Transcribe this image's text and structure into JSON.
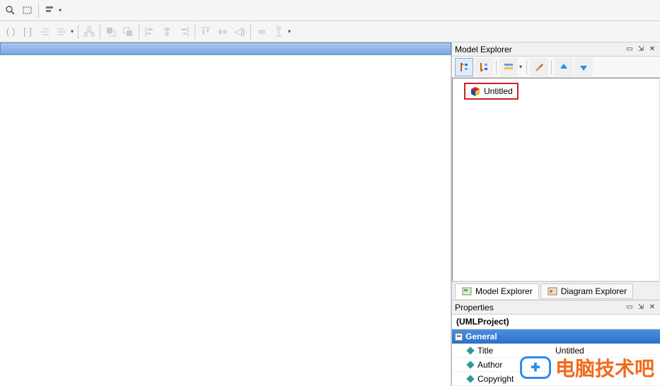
{
  "toolbars": {
    "row1": {
      "buttons": [
        "zoom",
        "rectangle-select",
        "align"
      ]
    },
    "row2": {
      "buttons": [
        "parentheses",
        "brackets",
        "outdent",
        "indent",
        "ungroup",
        "group-fwd",
        "group-back",
        "align-left",
        "align-center",
        "align-right",
        "dist-h",
        "dist-v",
        "speaker",
        "infinity",
        "legend-toggle"
      ]
    }
  },
  "canvas": {
    "title": ""
  },
  "model_explorer": {
    "title": "Model Explorer",
    "toolbar": [
      "sort-a",
      "sort-b",
      "stack",
      "brush",
      "up",
      "down"
    ],
    "root_label": "Untitled",
    "tabs": [
      {
        "label": "Model Explorer",
        "active": true
      },
      {
        "label": "Diagram Explorer",
        "active": false
      }
    ]
  },
  "properties": {
    "title": "Properties",
    "type_label": "(UMLProject)",
    "category": "General",
    "rows": [
      {
        "name": "Title",
        "value": "Untitled"
      },
      {
        "name": "Author",
        "value": ""
      },
      {
        "name": "Copyright",
        "value": ""
      }
    ]
  },
  "watermark": {
    "text": "电脑技术吧"
  }
}
